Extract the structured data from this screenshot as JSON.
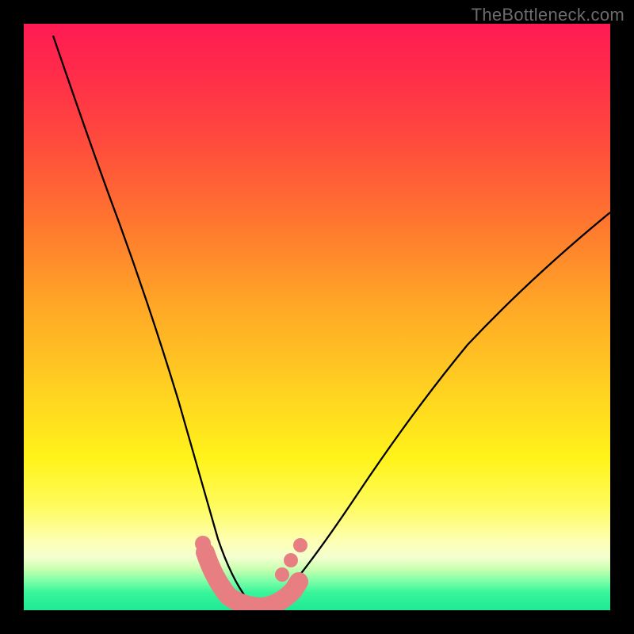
{
  "watermark": "TheBottleneck.com",
  "chart_data": {
    "type": "line",
    "title": "",
    "xlabel": "",
    "ylabel": "",
    "xlim": [
      0,
      100
    ],
    "ylim": [
      0,
      100
    ],
    "series": [
      {
        "name": "left-curve",
        "x": [
          5,
          10,
          15,
          20,
          25,
          30,
          33,
          36,
          38,
          40
        ],
        "values": [
          98,
          84,
          66,
          47,
          28,
          11,
          5,
          2,
          1,
          0.5
        ]
      },
      {
        "name": "right-curve",
        "x": [
          40,
          42,
          44,
          48,
          55,
          65,
          75,
          85,
          95,
          100
        ],
        "values": [
          0.5,
          1,
          2,
          5,
          14,
          28,
          42,
          54,
          64,
          68
        ]
      },
      {
        "name": "valley-floor",
        "x": [
          36,
          40,
          44
        ],
        "values": [
          0.7,
          0.5,
          0.7
        ]
      }
    ],
    "markers": [
      {
        "series": "left-curve",
        "x": 30.5,
        "y": 10.5
      },
      {
        "series": "left-curve",
        "x": 31.5,
        "y": 8.0
      },
      {
        "series": "right-curve",
        "x": 44.0,
        "y": 6.0
      },
      {
        "series": "right-curve",
        "x": 45.5,
        "y": 8.5
      },
      {
        "series": "right-curve",
        "x": 47.0,
        "y": 11.0
      }
    ],
    "valley_band": {
      "x_start": 33,
      "x_end": 45,
      "y": 1.2
    },
    "gradient_stops": [
      {
        "pos": 0.0,
        "color": "#ff1a53"
      },
      {
        "pos": 0.35,
        "color": "#ff7a2e"
      },
      {
        "pos": 0.74,
        "color": "#fff31a"
      },
      {
        "pos": 0.95,
        "color": "#7effa8"
      },
      {
        "pos": 1.0,
        "color": "#1fea95"
      }
    ]
  }
}
